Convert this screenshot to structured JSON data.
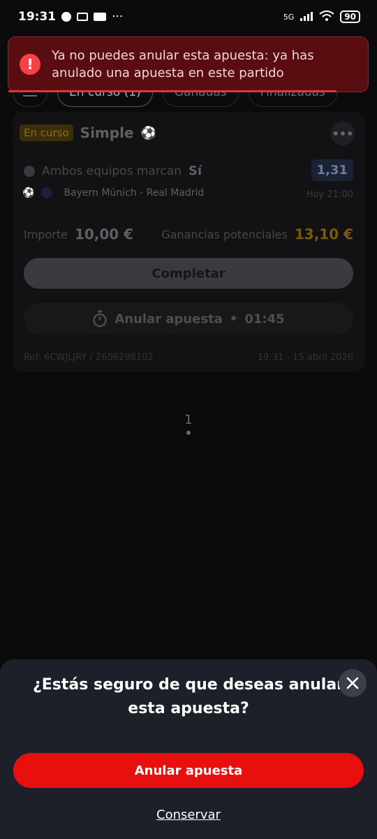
{
  "status_bar": {
    "time": "19:31",
    "network": "5G",
    "battery": "90"
  },
  "tabs": [
    {
      "label": "En curso (1)"
    },
    {
      "label": "Ganadas"
    },
    {
      "label": "Finalizadas"
    }
  ],
  "bet": {
    "status_badge": "En curso",
    "type": "Simple",
    "market": "Ambos equipos marcan",
    "selection": "Sí",
    "odds": "1,31",
    "match": "Bayern Múnich - Real Madrid",
    "match_time": "Hoy 21:00",
    "stake_label": "Importe",
    "stake": "10,00 €",
    "winnings_label": "Ganancias potenciales",
    "winnings": "13,10 €",
    "complete_label": "Completar",
    "cancel_label": "Anular apuesta",
    "cancel_separator": "•",
    "cancel_timer": "01:45",
    "ref": "Ref: 6CWJLJRY / 2606298102",
    "placed_at": "19:31 - 15 abril 2026"
  },
  "pagination": {
    "page": "1"
  },
  "toast": {
    "message": "Ya no puedes anular esta apuesta: ya has anulado una apuesta en este partido"
  },
  "sheet": {
    "title": "¿Estás seguro de que deseas anular esta apuesta?",
    "confirm_label": "Anular apuesta",
    "keep_label": "Conservar"
  },
  "colors": {
    "accent_red": "#e8100f",
    "toast_bg": "#5a0d11",
    "sheet_bg": "#1e2029"
  }
}
